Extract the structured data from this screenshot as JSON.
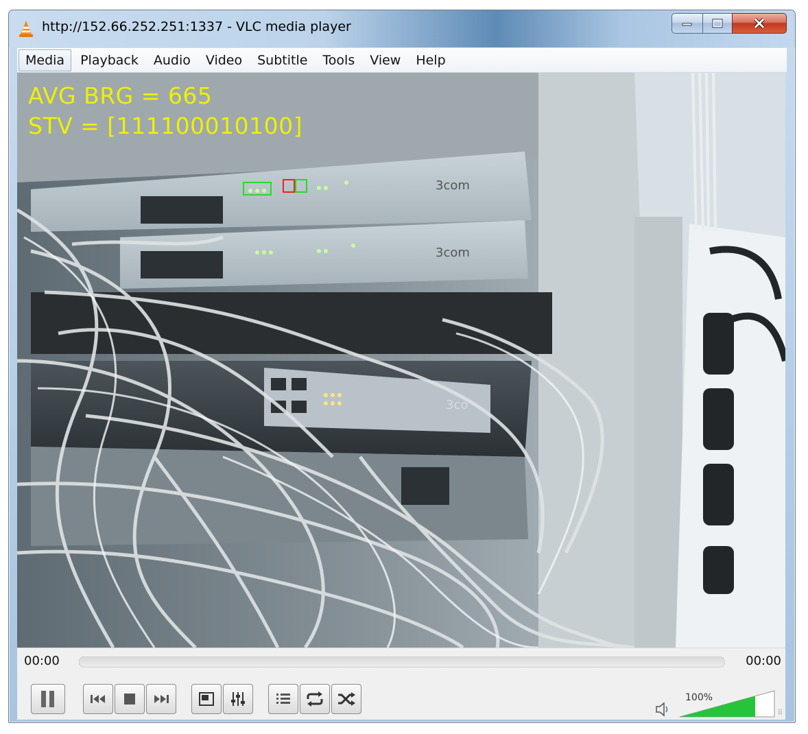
{
  "window": {
    "title": "http://152.66.252.251:1337 - VLC media player"
  },
  "menu": {
    "items": [
      "Media",
      "Playback",
      "Audio",
      "Video",
      "Subtitle",
      "Tools",
      "View",
      "Help"
    ]
  },
  "overlay": {
    "line1": "AVG BRG = 665",
    "line2": "STV = [111100010100]"
  },
  "playback": {
    "elapsed": "00:00",
    "total": "00:00",
    "position": 0
  },
  "volume": {
    "label": "100%",
    "level": 1.0
  },
  "colors": {
    "osd_text": "#f0f000",
    "volume_fill": "#27c43a",
    "close_button": "#c8452c"
  },
  "icons": {
    "pause": "pause-icon",
    "previous": "skip-previous-icon",
    "stop": "stop-icon",
    "next": "skip-next-icon",
    "fullscreen": "fullscreen-icon",
    "extended_settings": "equalizer-icon",
    "playlist": "playlist-icon",
    "loop": "loop-icon",
    "random": "shuffle-icon",
    "mute": "speaker-icon"
  }
}
